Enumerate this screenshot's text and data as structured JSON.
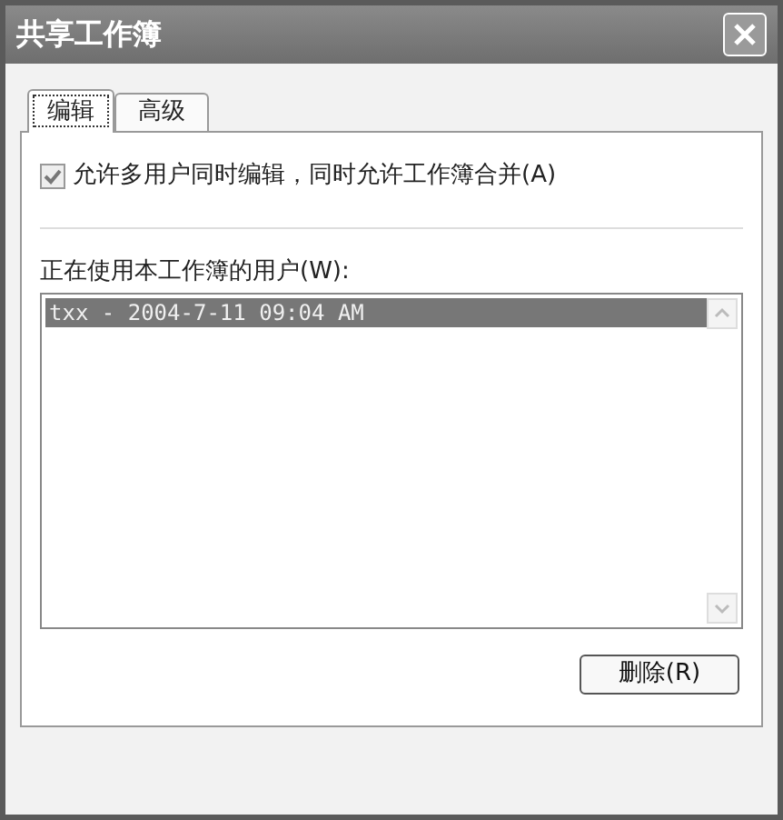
{
  "window": {
    "title": "共享工作簿"
  },
  "tabs": [
    {
      "label": "编辑",
      "selected": true
    },
    {
      "label": "高级",
      "selected": false
    }
  ],
  "allow_multi_user": {
    "label": "允许多用户同时编辑，同时允许工作簿合并(A)",
    "checked": true
  },
  "users": {
    "label": "正在使用本工作簿的用户(W):",
    "rows": [
      {
        "text": "txx - 2004-7-11 09:04 AM",
        "selected": true
      }
    ]
  },
  "buttons": [
    {
      "label": "删除(R)"
    }
  ]
}
